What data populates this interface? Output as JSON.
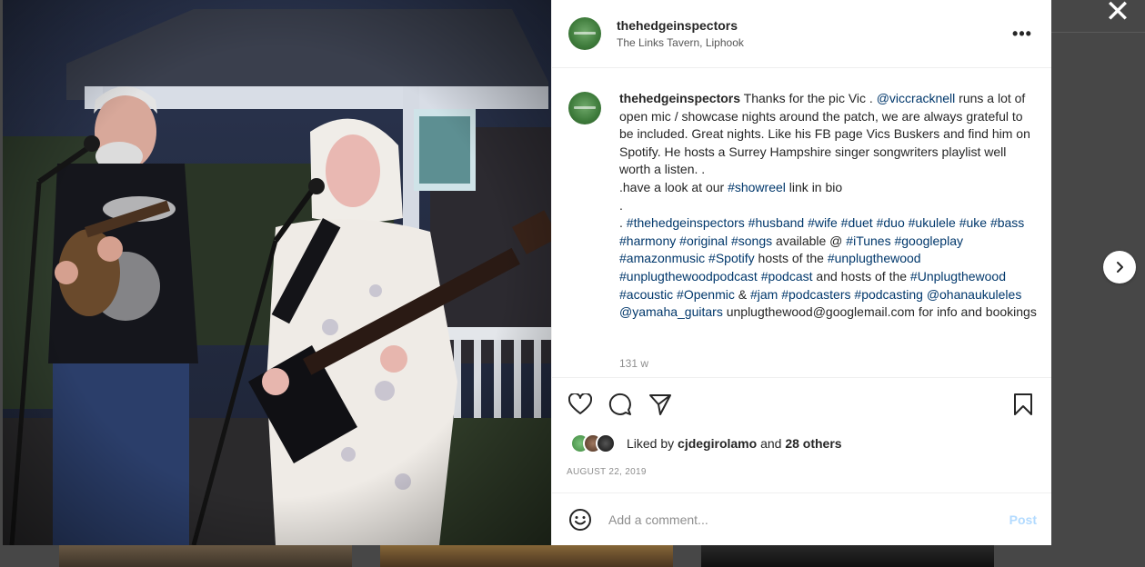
{
  "post": {
    "username": "thehedgeinspectors",
    "location": "The Links Tavern, Liphook",
    "more_icon": "more-horizontal-icon"
  },
  "caption": {
    "username": "thehedgeinspectors",
    "segments": [
      {
        "t": " Thanks for the pic Vic . "
      },
      {
        "t": "@viccracknell",
        "tag": true
      },
      {
        "t": " runs a lot of open mic / showcase nights around the patch, we are always grateful to be included. Great nights. Like his FB page Vics Buskers and find him on Spotify. He hosts a Surrey Hampshire singer songwriters playlist well worth a listen. ."
      },
      {
        "br": true
      },
      {
        "t": ".have a look at our "
      },
      {
        "t": "#showreel",
        "tag": true
      },
      {
        "t": " link in bio"
      },
      {
        "br": true
      },
      {
        "t": "."
      },
      {
        "br": true
      },
      {
        "t": ". "
      },
      {
        "t": "#thehedgeinspectors",
        "tag": true
      },
      {
        "t": " "
      },
      {
        "t": "#husband",
        "tag": true
      },
      {
        "t": " "
      },
      {
        "t": "#wife",
        "tag": true
      },
      {
        "t": " "
      },
      {
        "t": "#duet",
        "tag": true
      },
      {
        "t": " "
      },
      {
        "t": "#duo",
        "tag": true
      },
      {
        "t": " "
      },
      {
        "t": "#ukulele",
        "tag": true
      },
      {
        "t": " "
      },
      {
        "t": "#uke",
        "tag": true
      },
      {
        "t": " "
      },
      {
        "t": "#bass",
        "tag": true
      },
      {
        "t": " "
      },
      {
        "t": "#harmony",
        "tag": true
      },
      {
        "t": " "
      },
      {
        "t": "#original",
        "tag": true
      },
      {
        "t": " "
      },
      {
        "t": "#songs",
        "tag": true
      },
      {
        "t": " available @ "
      },
      {
        "t": "#iTunes",
        "tag": true
      },
      {
        "t": " "
      },
      {
        "t": "#googleplay",
        "tag": true
      },
      {
        "t": " "
      },
      {
        "t": "#amazonmusic",
        "tag": true
      },
      {
        "t": " "
      },
      {
        "t": "#Spotify",
        "tag": true
      },
      {
        "t": " hosts of the "
      },
      {
        "t": "#unplugthewood",
        "tag": true
      },
      {
        "t": " "
      },
      {
        "t": "#unplugthewoodpodcast",
        "tag": true
      },
      {
        "t": " "
      },
      {
        "t": "#podcast",
        "tag": true
      },
      {
        "t": " and hosts of the "
      },
      {
        "t": "#Unplugthewood",
        "tag": true
      },
      {
        "t": " "
      },
      {
        "t": "#acoustic",
        "tag": true
      },
      {
        "t": " "
      },
      {
        "t": "#Openmic",
        "tag": true
      },
      {
        "t": " & "
      },
      {
        "t": "#jam",
        "tag": true
      },
      {
        "t": " "
      },
      {
        "t": "#podcasters",
        "tag": true
      },
      {
        "t": " "
      },
      {
        "t": "#podcasting",
        "tag": true
      },
      {
        "t": " "
      },
      {
        "t": "@ohanaukuleles",
        "tag": true
      },
      {
        "t": " "
      },
      {
        "t": "@yamaha_guitars",
        "tag": true
      },
      {
        "t": " unplugthewood@googlemail.com for info and bookings"
      }
    ],
    "timestamp": "131 w"
  },
  "actions": {
    "like_icon": "heart-icon",
    "comment_icon": "comment-icon",
    "share_icon": "paper-plane-icon",
    "save_icon": "bookmark-icon"
  },
  "likes": {
    "prefix": "Liked by ",
    "user": "cjdegirolamo",
    "middle": " and ",
    "others": "28 others"
  },
  "date": "AUGUST 22, 2019",
  "comment_box": {
    "placeholder": "Add a comment...",
    "post_label": "Post",
    "emoji_icon": "smiley-icon"
  },
  "overlay": {
    "close_icon": "close-icon",
    "next_icon": "chevron-right-icon"
  },
  "colors": {
    "link": "#00376b",
    "post_disabled": "#b3dbff",
    "muted": "#8e8e8e"
  }
}
